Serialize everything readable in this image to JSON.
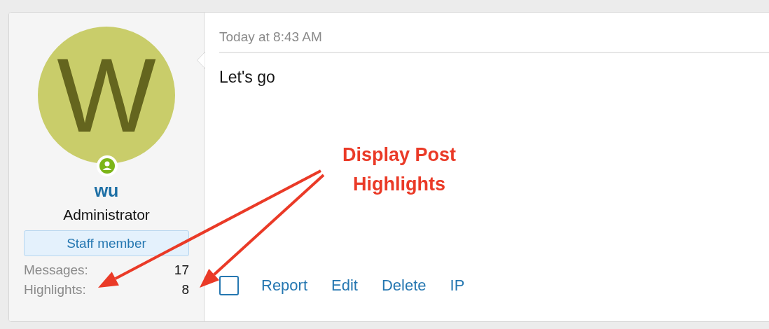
{
  "author": {
    "avatar_letter": "W",
    "online": true,
    "name": "wu",
    "title": "Administrator",
    "banner": "Staff member",
    "stats": [
      {
        "label": "Messages:",
        "value": "17"
      },
      {
        "label": "Highlights:",
        "value": "8"
      }
    ]
  },
  "post": {
    "time": "Today at 8:43 AM",
    "body": "Let's go",
    "selected": false,
    "actions": [
      "Report",
      "Edit",
      "Delete",
      "IP"
    ]
  },
  "annotation": {
    "text": "Display Post Highlights"
  }
}
